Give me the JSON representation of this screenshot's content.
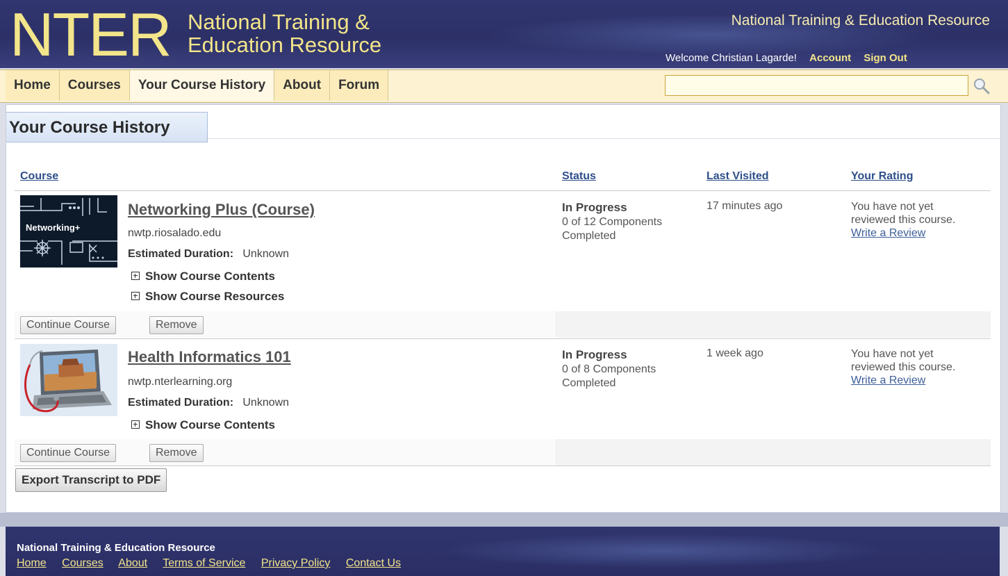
{
  "header": {
    "logo_abbr": "NTER",
    "logo_line1": "National Training &",
    "logo_line2": "Education Resource",
    "site_title": "National Training & Education Resource",
    "welcome": "Welcome Christian Lagarde!",
    "account_label": "Account",
    "signout_label": "Sign Out"
  },
  "nav": {
    "items": [
      {
        "label": "Home"
      },
      {
        "label": "Courses"
      },
      {
        "label": "Your Course History"
      },
      {
        "label": "About"
      },
      {
        "label": "Forum"
      }
    ],
    "search_value": "",
    "search_icon": "magnifier-icon"
  },
  "page": {
    "title": "Your Course History"
  },
  "table": {
    "columns": {
      "course": "Course",
      "status": "Status",
      "last_visited": "Last Visited",
      "rating": "Your Rating"
    },
    "rows": [
      {
        "thumb_label": "Networking+",
        "title": "Networking Plus (Course)",
        "url": "nwtp.riosalado.edu",
        "duration_label": "Estimated Duration:",
        "duration_value": "Unknown",
        "expanders": [
          "Show Course Contents",
          "Show Course Resources"
        ],
        "status": "In Progress",
        "status_detail_1": "0 of 12 Components",
        "status_detail_2": "Completed",
        "last_visited": "17 minutes ago",
        "rating_line1": "You have not yet",
        "rating_line2": "reviewed this course.",
        "rating_link": "Write a Review",
        "continue_label": "Continue Course",
        "remove_label": "Remove"
      },
      {
        "title": "Health Informatics 101",
        "url": "nwtp.nterlearning.org",
        "duration_label": "Estimated Duration:",
        "duration_value": "Unknown",
        "expanders": [
          "Show Course Contents"
        ],
        "status": "In Progress",
        "status_detail_1": "0 of 8 Components",
        "status_detail_2": "Completed",
        "last_visited": "1 week ago",
        "rating_line1": "You have not yet",
        "rating_line2": "reviewed this course.",
        "rating_link": "Write a Review",
        "continue_label": "Continue Course",
        "remove_label": "Remove"
      }
    ],
    "export_label": "Export Transcript to PDF"
  },
  "footer": {
    "title": "National Training & Education Resource",
    "links": [
      "Home",
      "Courses",
      "About",
      "Terms of Service",
      "Privacy Policy",
      "Contact Us"
    ]
  },
  "colors": {
    "header_bg": "#2c3067",
    "logo_yellow": "#f3e58a",
    "nav_bg": "#fcecbc",
    "link_blue": "#2d4e8a"
  }
}
